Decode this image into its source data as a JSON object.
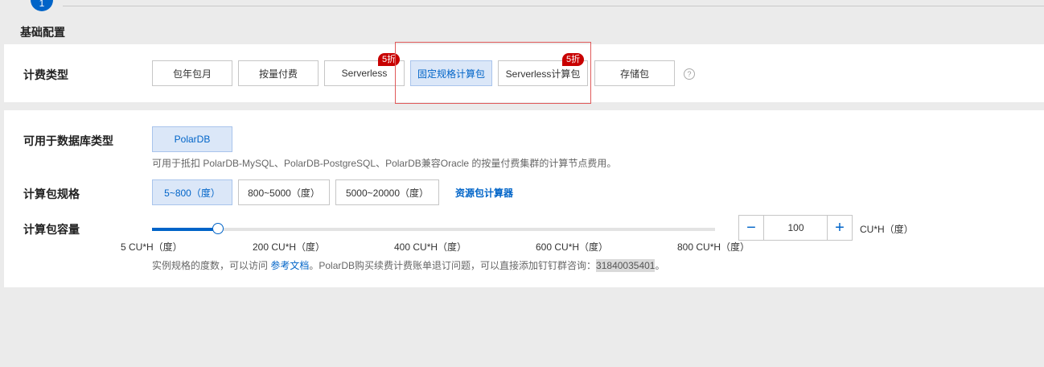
{
  "step": {
    "number": "1"
  },
  "section": {
    "title": "基础配置"
  },
  "billing": {
    "label": "计费类型",
    "options": [
      "包年包月",
      "按量付费",
      "Serverless",
      "固定规格计算包",
      "Serverless计算包",
      "存储包"
    ],
    "badges": [
      "5折",
      "5折"
    ],
    "help_icon": "question-circle-icon",
    "selected": "固定规格计算包"
  },
  "db_type": {
    "label": "可用于数据库类型",
    "option": "PolarDB",
    "desc": "可用于抵扣 PolarDB-MySQL、PolarDB-PostgreSQL、PolarDB兼容Oracle 的按量付费集群的计算节点费用。"
  },
  "spec": {
    "label": "计算包规格",
    "options": [
      "5~800（度）",
      "800~5000（度）",
      "5000~20000（度）"
    ],
    "selected": "5~800（度）",
    "calculator_link": "资源包计算器"
  },
  "capacity": {
    "label": "计算包容量",
    "ticks": [
      "5 CU*H（度）",
      "200 CU*H（度）",
      "400 CU*H（度）",
      "600 CU*H（度）",
      "800 CU*H（度）"
    ],
    "slider_value": 100,
    "value": "100",
    "unit": "CU*H（度）",
    "minus": "−",
    "plus": "+",
    "note_prefix": "实例规格的度数，可以访问 ",
    "note_link": "参考文档",
    "note_middle": "。PolarDB购买续费计费账单退订问题，可以直接添加钉钉群咨询：",
    "note_number": "31840035401",
    "note_suffix": "。"
  },
  "colors": {
    "accent": "#0064c8",
    "badge": "#c80000",
    "selected_bg": "#dbe7f8"
  }
}
